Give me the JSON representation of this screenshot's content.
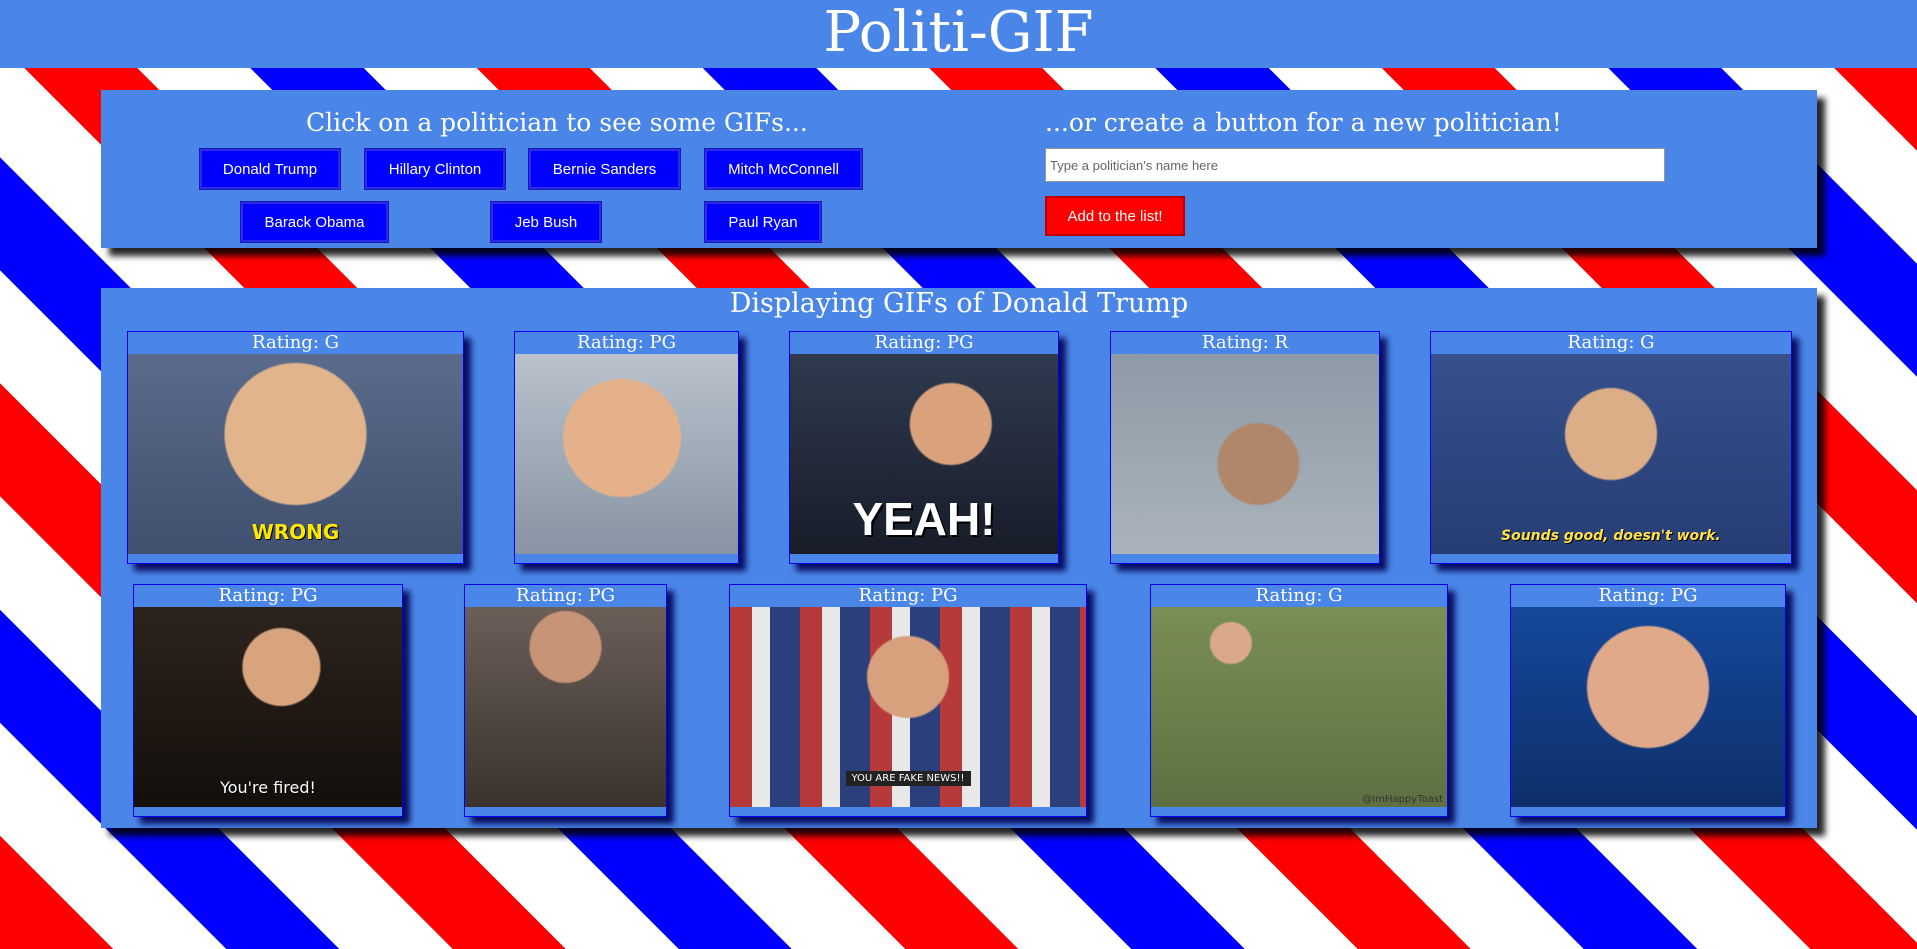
{
  "header": {
    "title": "Politi-GIF"
  },
  "politicians": {
    "heading": "Click on a politician to see some GIFs...",
    "buttons": [
      "Donald Trump",
      "Hillary Clinton",
      "Bernie Sanders",
      "Mitch McConnell",
      "Barack Obama",
      "Jeb Bush",
      "Paul Ryan"
    ]
  },
  "create": {
    "heading": "...or create a button for a new politician!",
    "placeholder": "Type a politician's name here",
    "value": "",
    "add_label": "Add to the list!"
  },
  "gifs": {
    "heading": "Displaying GIFs of Donald Trump",
    "items": [
      {
        "rating": "Rating: G",
        "caption": "WRONG"
      },
      {
        "rating": "Rating: PG",
        "caption": ""
      },
      {
        "rating": "Rating: PG",
        "caption": "YEAH!"
      },
      {
        "rating": "Rating: R",
        "caption": ""
      },
      {
        "rating": "Rating: G",
        "caption": "Sounds good, doesn't work."
      },
      {
        "rating": "Rating: PG",
        "caption": "You're fired!"
      },
      {
        "rating": "Rating: PG",
        "caption": ""
      },
      {
        "rating": "Rating: PG",
        "caption": "YOU ARE FAKE NEWS!!"
      },
      {
        "rating": "Rating: G",
        "caption": "@ImHappyToast"
      },
      {
        "rating": "Rating: PG",
        "caption": ""
      }
    ]
  },
  "colors": {
    "panel": "#4a86e8",
    "button": "#0000ff",
    "add_button": "#ff0000",
    "stripe_red": "#ff0000",
    "stripe_blue": "#0000ff"
  }
}
